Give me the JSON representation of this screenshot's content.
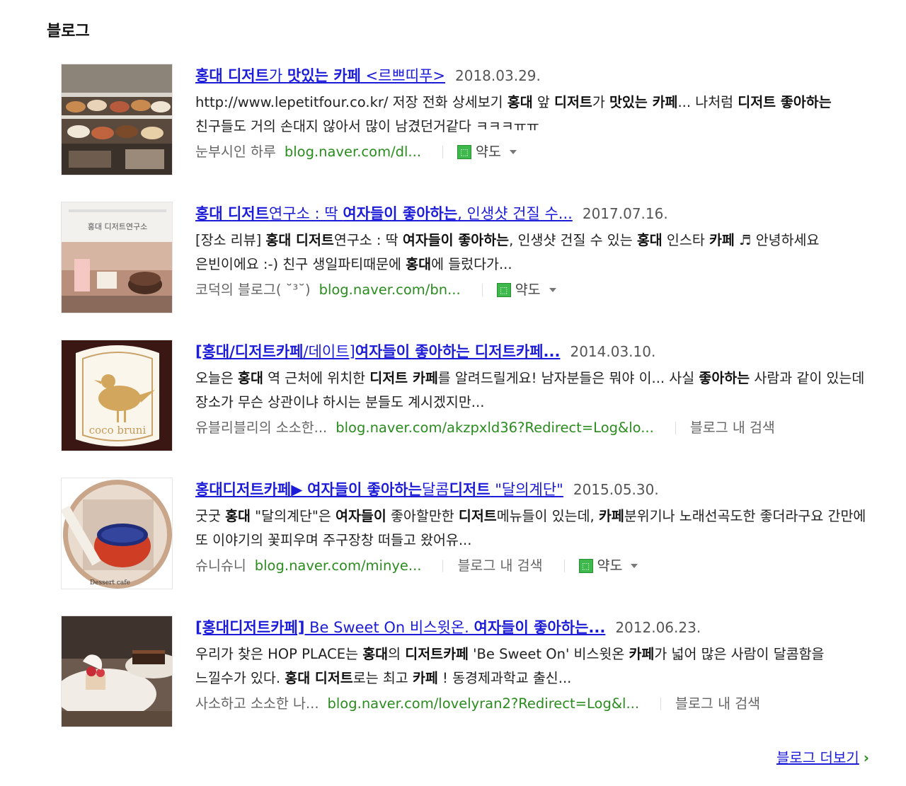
{
  "section": {
    "title": "블로그"
  },
  "results": [
    {
      "title_parts": [
        {
          "t": "홍대 디저트",
          "b": true
        },
        {
          "t": "가 ",
          "b": false
        },
        {
          "t": "맛있는 카페",
          "b": true
        },
        {
          "t": " <르쁘띠푸>",
          "b": false
        }
      ],
      "date": "2018.03.29.",
      "snippet_parts": [
        {
          "t": "http://www.lepetitfour.co.kr/ 저장 전화 상세보기 ",
          "b": false
        },
        {
          "t": "홍대",
          "b": true
        },
        {
          "t": " 앞 ",
          "b": false
        },
        {
          "t": "디저트",
          "b": true
        },
        {
          "t": "가 ",
          "b": false
        },
        {
          "t": "맛있는 카페",
          "b": true
        },
        {
          "t": "... 나처럼 ",
          "b": false
        },
        {
          "t": "디저트 좋아하는",
          "b": true
        },
        {
          "t": " 친구들도 거의 손대지 않아서 많이 남겼던거같다 ㅋㅋㅋㅠㅠ",
          "b": false
        }
      ],
      "author": "눈부시인 하루",
      "url": "blog.naver.com/dl...",
      "inner_search": "",
      "map": {
        "icon": "map-marker-icon",
        "label": "약도"
      }
    },
    {
      "title_parts": [
        {
          "t": "홍대 디저트",
          "b": true
        },
        {
          "t": "연구소 : 딱 ",
          "b": false
        },
        {
          "t": "여자들이 좋아하는",
          "b": true
        },
        {
          "t": ", 인생샷 건질 수...",
          "b": false
        }
      ],
      "date": "2017.07.16.",
      "snippet_parts": [
        {
          "t": "[장소 리뷰] ",
          "b": false
        },
        {
          "t": "홍대 디저트",
          "b": true
        },
        {
          "t": "연구소 : 딱 ",
          "b": false
        },
        {
          "t": "여자들이 좋아하는",
          "b": true
        },
        {
          "t": ", 인생샷 건질 수 있는 ",
          "b": false
        },
        {
          "t": "홍대",
          "b": true
        },
        {
          "t": " 인스타 ",
          "b": false
        },
        {
          "t": "카페",
          "b": true
        },
        {
          "t": " ♬ 안녕하세요 은빈이에요 :-) 친구 생일파티때문에 ",
          "b": false
        },
        {
          "t": "홍대",
          "b": true
        },
        {
          "t": "에 들렀다가...",
          "b": false
        }
      ],
      "author": "코덕의 블로그( ˘³˘)",
      "url": "blog.naver.com/bn...",
      "inner_search": "",
      "map": {
        "icon": "map-marker-icon",
        "label": "약도"
      }
    },
    {
      "title_parts": [
        {
          "t": "[홍대/디저트카페",
          "b": true
        },
        {
          "t": "/데이트]",
          "b": false
        },
        {
          "t": "여자들이 좋아하는 디저트카페...",
          "b": true
        }
      ],
      "date": "2014.03.10.",
      "snippet_parts": [
        {
          "t": "오늘은 ",
          "b": false
        },
        {
          "t": "홍대",
          "b": true
        },
        {
          "t": " 역 근처에 위치한 ",
          "b": false
        },
        {
          "t": "디저트 카페",
          "b": true
        },
        {
          "t": "를 알려드릴게요! 남자분들은 뭐야 이... 사실 ",
          "b": false
        },
        {
          "t": "좋아하는",
          "b": true
        },
        {
          "t": " 사람과 같이 있는데 장소가 무슨 상관이냐 하시는 분들도 계시겠지만...",
          "b": false
        }
      ],
      "author": "유블리블리의 소소한...",
      "url": "blog.naver.com/akzpxld36?Redirect=Log&lo...",
      "inner_search": "블로그 내 검색",
      "map": null
    },
    {
      "title_parts": [
        {
          "t": "홍대디저트카페",
          "b": true
        },
        {
          "t": "▶ ",
          "b": false
        },
        {
          "t": "여자들이 좋아하는",
          "b": true
        },
        {
          "t": "달콤",
          "b": false
        },
        {
          "t": "디저트",
          "b": true
        },
        {
          "t": " \"달의계단\"",
          "b": false
        }
      ],
      "date": "2015.05.30.",
      "snippet_parts": [
        {
          "t": "굿굿 ",
          "b": false
        },
        {
          "t": "홍대",
          "b": true
        },
        {
          "t": " \"달의계단\"은 ",
          "b": false
        },
        {
          "t": "여자들이",
          "b": true
        },
        {
          "t": " 좋아할만한 ",
          "b": false
        },
        {
          "t": "디저트",
          "b": true
        },
        {
          "t": "메뉴들이 있는데, ",
          "b": false
        },
        {
          "t": "카페",
          "b": true
        },
        {
          "t": "분위기나 노래선곡도한 좋더라구요 간만에 또 이야기의 꽃피우며 주구장창 떠들고 왔어유...",
          "b": false
        }
      ],
      "author": "슈니슈니",
      "url": "blog.naver.com/minye...",
      "inner_search": "블로그 내 검색",
      "map": {
        "icon": "map-marker-icon",
        "label": "약도"
      }
    },
    {
      "title_parts": [
        {
          "t": "[홍대디저트카페]",
          "b": true
        },
        {
          "t": " Be Sweet On 비스윗온. ",
          "b": false
        },
        {
          "t": "여자들이 좋아하는...",
          "b": true
        }
      ],
      "date": "2012.06.23.",
      "snippet_parts": [
        {
          "t": "우리가 찾은 HOP PLACE는 ",
          "b": false
        },
        {
          "t": "홍대",
          "b": true
        },
        {
          "t": "의 ",
          "b": false
        },
        {
          "t": "디저트카페",
          "b": true
        },
        {
          "t": " 'Be Sweet On' 비스윗온 ",
          "b": false
        },
        {
          "t": "카페",
          "b": true
        },
        {
          "t": "가 넓어 많은 사람이 달콤함을 느낄수가 있다. ",
          "b": false
        },
        {
          "t": "홍대 디저트",
          "b": true
        },
        {
          "t": "로는 최고 ",
          "b": false
        },
        {
          "t": "카페",
          "b": true
        },
        {
          "t": " ! 동경제과학교 출신...",
          "b": false
        }
      ],
      "author": "사소하고 소소한 나...",
      "url": "blog.naver.com/lovelyran2?Redirect=Log&l...",
      "inner_search": "블로그 내 검색",
      "map": null
    }
  ],
  "more": {
    "label": "블로그 더보기",
    "icon": "chevron-right-icon"
  },
  "colors": {
    "link": "#1c1cd8",
    "url": "#2a8c1e",
    "map": "#3db84a"
  }
}
